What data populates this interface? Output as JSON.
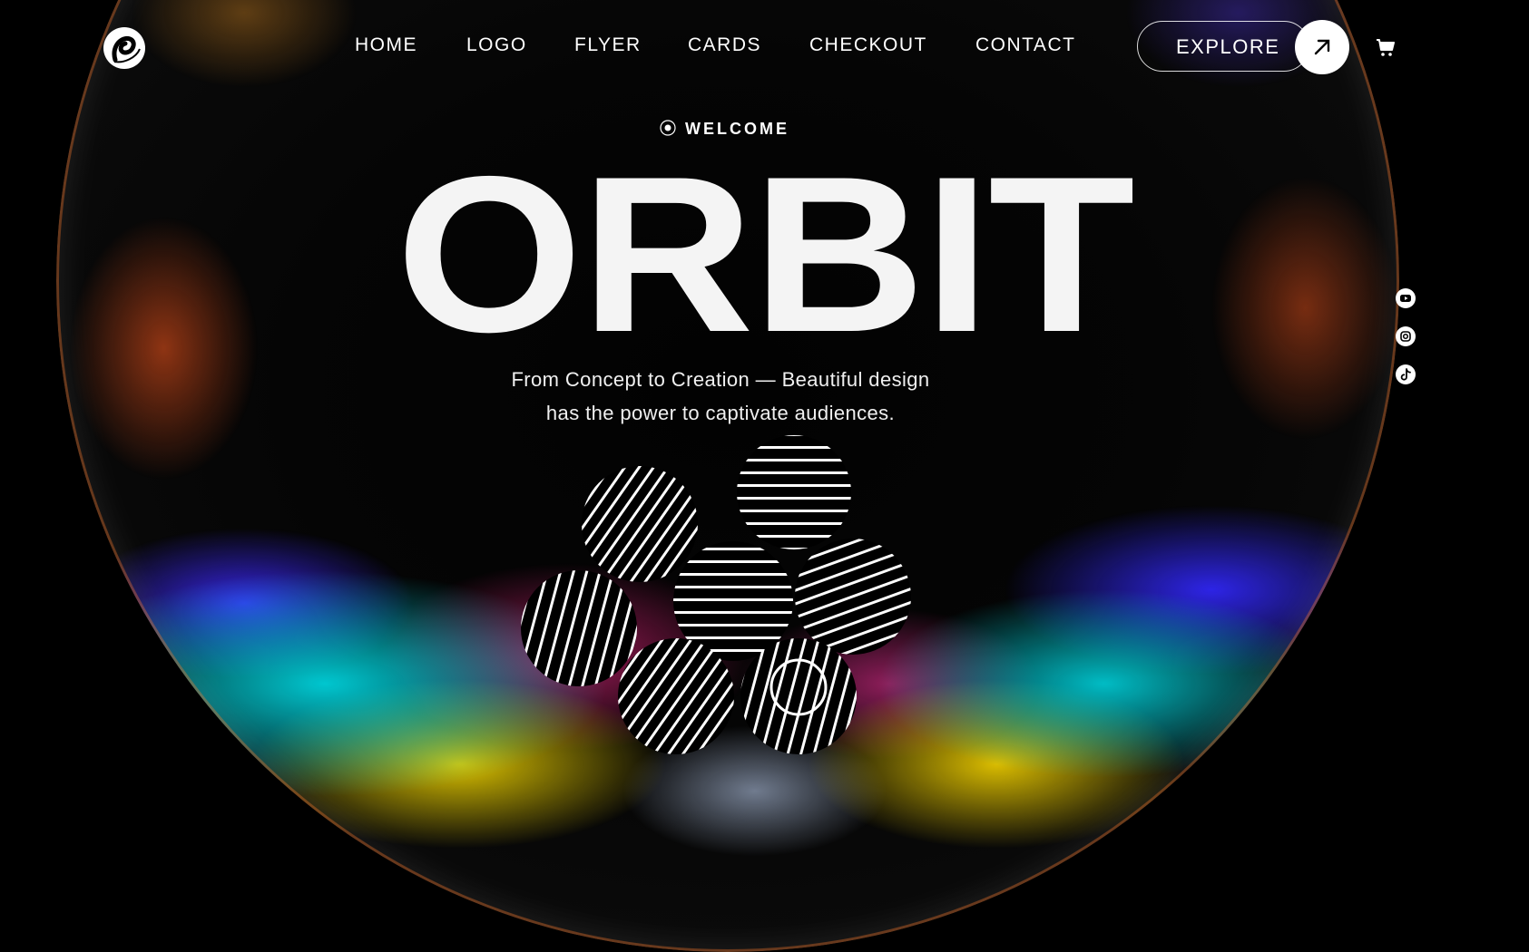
{
  "brand": {
    "logo_icon": "orbit-swirl-logo-icon"
  },
  "nav": {
    "items": [
      {
        "label": "HOME"
      },
      {
        "label": "LOGO"
      },
      {
        "label": "FLYER"
      },
      {
        "label": "CARDS"
      },
      {
        "label": "CHECKOUT"
      },
      {
        "label": "CONTACT"
      }
    ]
  },
  "cta": {
    "explore_label": "EXPLORE",
    "arrow_icon": "arrow-up-right-icon"
  },
  "cart": {
    "icon": "shopping-cart-icon"
  },
  "hero": {
    "eyebrow": "WELCOME",
    "title": "ORBIT",
    "subtitle_line1": "From Concept to Creation — Beautiful design",
    "subtitle_line2": "has the power to captivate audiences."
  },
  "social": [
    {
      "icon": "youtube-icon"
    },
    {
      "icon": "instagram-icon"
    },
    {
      "icon": "tiktok-icon"
    }
  ],
  "colors": {
    "background": "#000000",
    "text": "#ffffff",
    "title": "#f4f4f4"
  }
}
